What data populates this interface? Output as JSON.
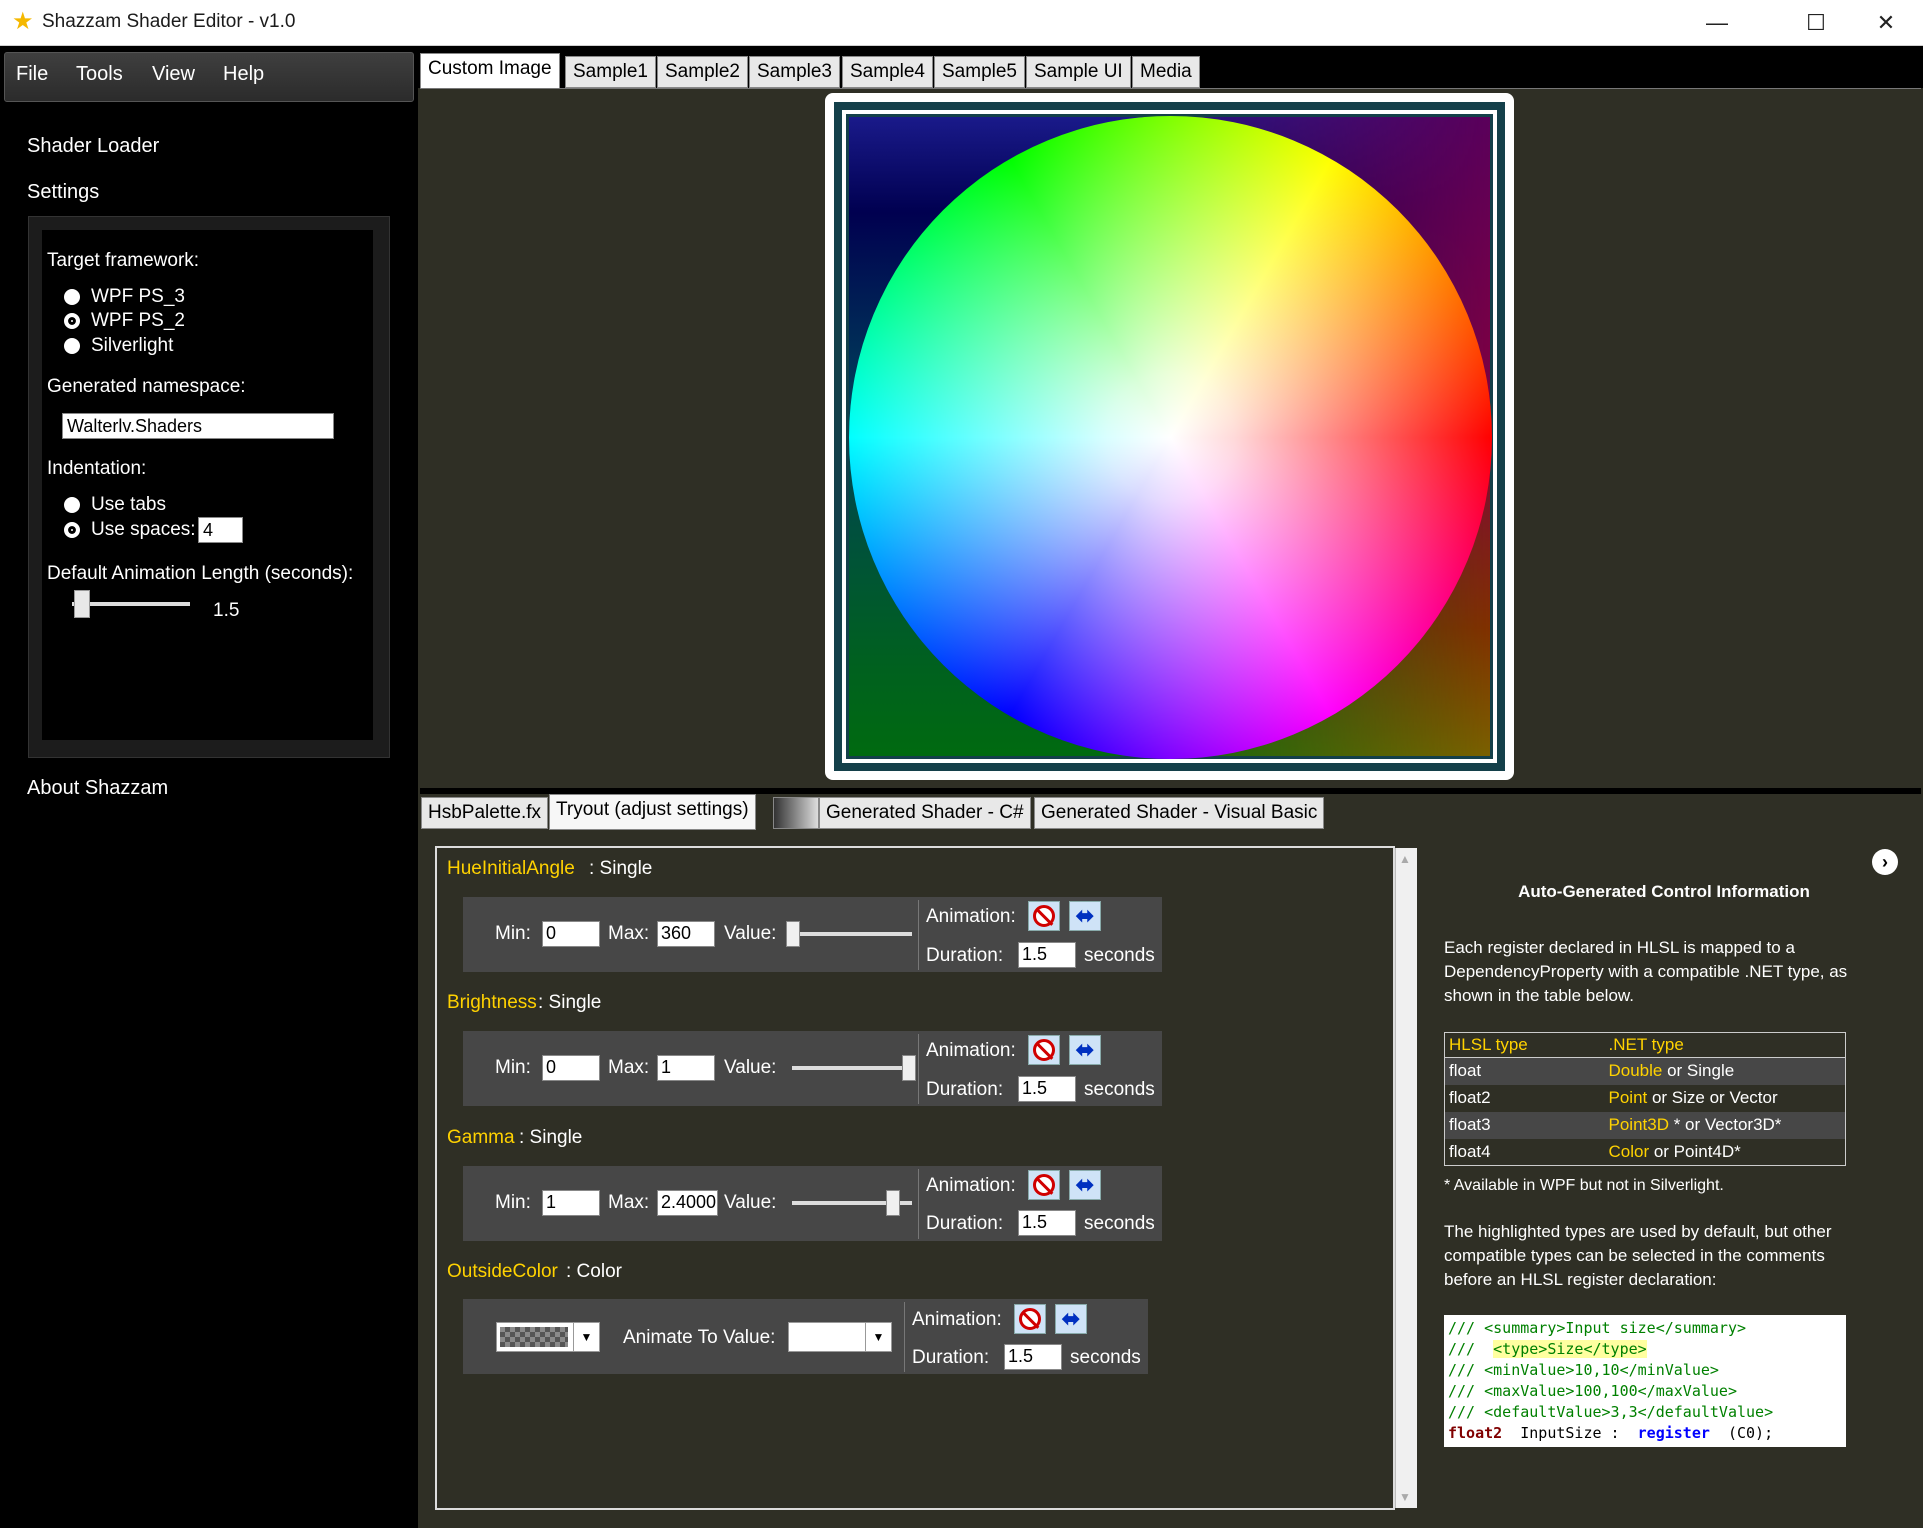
{
  "window": {
    "title": "Shazzam Shader Editor - v1.0",
    "minimize": "—",
    "maximize": "☐",
    "close": "✕"
  },
  "menu": {
    "file": "File",
    "tools": "Tools",
    "view": "View",
    "help": "Help"
  },
  "nav": {
    "shader_loader": "Shader Loader",
    "settings": "Settings",
    "about": "About Shazzam"
  },
  "settings": {
    "target_framework_label": "Target framework:",
    "frameworks": [
      "WPF PS_3",
      "WPF PS_2",
      "Silverlight"
    ],
    "selected_framework": "WPF PS_2",
    "namespace_label": "Generated namespace:",
    "namespace_value": "Walterlv.Shaders",
    "indentation_label": "Indentation:",
    "use_tabs": "Use tabs",
    "use_spaces": "Use spaces:",
    "spaces_value": "4",
    "anim_length_label": "Default Animation Length (seconds):",
    "anim_length_value": "1.5"
  },
  "top_tabs": [
    "Custom Image",
    "Sample1",
    "Sample2",
    "Sample3",
    "Sample4",
    "Sample5",
    "Sample UI",
    "Media"
  ],
  "bottom_tabs": {
    "file": "HsbPalette.fx",
    "tryout": "Tryout (adjust settings)",
    "cs": "Generated Shader - C#",
    "vb": "Generated Shader - Visual Basic"
  },
  "labels": {
    "min": "Min:",
    "max": "Max:",
    "value": "Value:",
    "animation": "Animation:",
    "duration": "Duration:",
    "seconds": "seconds",
    "animate_to": "Animate To Value:"
  },
  "properties": [
    {
      "name": "HueInitialAngle",
      "type": ": Single",
      "min": "0",
      "max": "360",
      "duration": "1.5",
      "slider": 0.0
    },
    {
      "name": "Brightness",
      "type": ": Single",
      "min": "0",
      "max": "1",
      "duration": "1.5",
      "slider": 1.0
    },
    {
      "name": "Gamma",
      "type": ": Single",
      "min": "1",
      "max": "2.4000",
      "duration": "1.5",
      "slider": 0.85
    },
    {
      "name": "OutsideColor",
      "type": ": Color",
      "duration": "1.5"
    }
  ],
  "info": {
    "title": "Auto-Generated Control Information",
    "p1": "Each register declared in HLSL is mapped to a DependencyProperty with a compatible .NET type, as shown in the table below.",
    "table_headers": [
      "HLSL type",
      ".NET type"
    ],
    "rows": [
      {
        "hlsl": "float",
        "net_hl": "Double",
        "net_rest": " or Single"
      },
      {
        "hlsl": "float2",
        "net_hl": "Point",
        "net_rest": " or Size or Vector"
      },
      {
        "hlsl": "float3",
        "net_hl": "Point3D",
        "net_rest": " * or Vector3D*"
      },
      {
        "hlsl": "float4",
        "net_hl": "Color",
        "net_rest": " or Point4D*"
      }
    ],
    "footnote": "* Available in WPF but not in Silverlight.",
    "p2": "The highlighted types are used by default, but other compatible types can be selected in the comments before an HLSL register declaration:",
    "code": {
      "l1": "/// <summary>Input size</summary>",
      "l2a": "///  ",
      "l2b": "<type>Size</type>",
      "l3": "/// <minValue>10,10</minValue>",
      "l4": "/// <maxValue>100,100</maxValue>",
      "l5": "/// <defaultValue>3,3</defaultValue>",
      "l6a": "float2",
      "l6b": "  InputSize :  ",
      "l6c": "register",
      "l6d": "  (C0);"
    }
  }
}
